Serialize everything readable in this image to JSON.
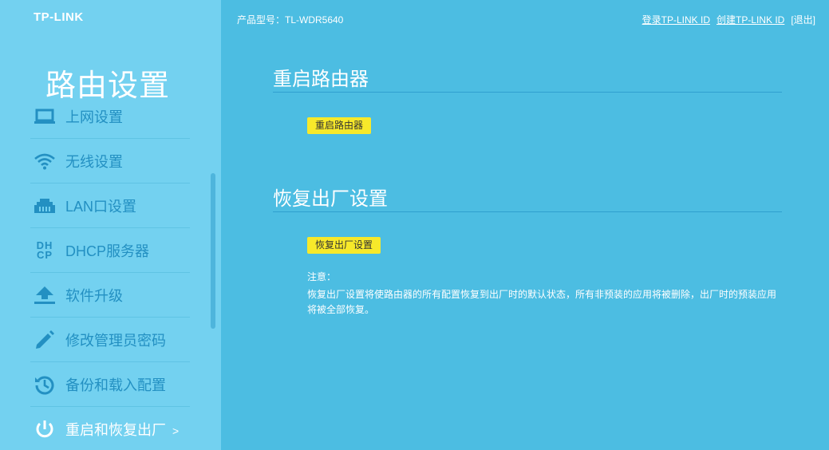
{
  "brand": {
    "logo": "TP-LINK"
  },
  "header": {
    "model": "产品型号：TL-WDR5640",
    "login_link": "登录TP-LINK ID",
    "create_link": "创建TP-LINK ID",
    "logout_link": "[退出]"
  },
  "sidebar": {
    "title": "路由设置",
    "items": [
      {
        "label": "上网设置",
        "icon": "laptop-icon"
      },
      {
        "label": "无线设置",
        "icon": "wifi-icon"
      },
      {
        "label": "LAN口设置",
        "icon": "lan-port-icon"
      },
      {
        "label": "DHCP服务器",
        "icon": "dhcp-icon",
        "icon_text_top": "DH",
        "icon_text_bottom": "CP"
      },
      {
        "label": "软件升级",
        "icon": "upload-icon"
      },
      {
        "label": "修改管理员密码",
        "icon": "pencil-icon"
      },
      {
        "label": "备份和载入配置",
        "icon": "history-icon"
      },
      {
        "label": "重启和恢复出厂",
        "icon": "power-icon",
        "active": true,
        "arrow": ">"
      }
    ]
  },
  "main": {
    "reboot": {
      "title": "重启路由器",
      "button": "重启路由器"
    },
    "factory_reset": {
      "title": "恢复出厂设置",
      "button": "恢复出厂设置",
      "note_label": "注意：",
      "note_line1": "恢复出厂设置将使路由器的所有配置恢复到出厂时的默认状态，所有非预装的应用将被删除，出厂时的预装应用",
      "note_line2": "将被全部恢复。"
    }
  },
  "colors": {
    "main_bg": "#4cbde2",
    "sidebar_bg": "#73d1f0",
    "accent_blue": "#2390c2",
    "button_yellow": "#f7e92a"
  }
}
